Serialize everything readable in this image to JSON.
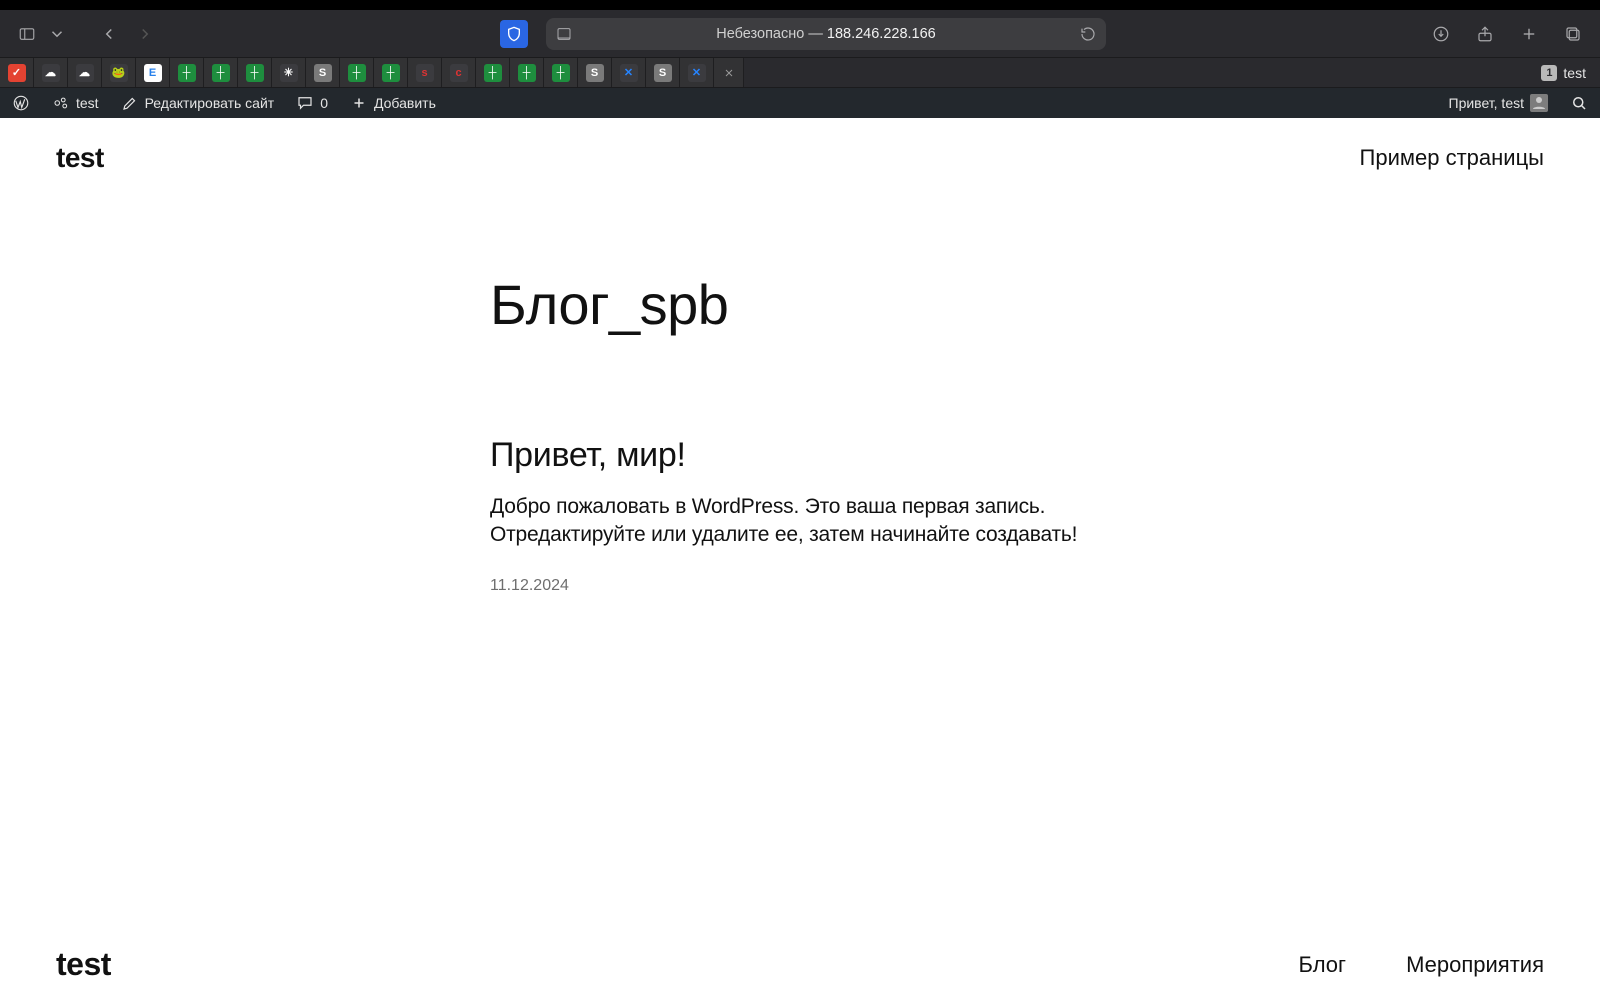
{
  "browser": {
    "address_insecure_label": "Небезопасно — ",
    "address_host": "188.246.228.166",
    "tab_badge": "1",
    "active_tab_title": "test"
  },
  "tabs_favicons": [
    {
      "name": "todoist-icon",
      "bg": "#e44332",
      "glyph": "✓"
    },
    {
      "name": "cloud-icon-1",
      "bg": "#3b3b3f",
      "glyph": "☁"
    },
    {
      "name": "cloud-icon-2",
      "bg": "#3b3b3f",
      "glyph": "☁"
    },
    {
      "name": "frog-icon",
      "bg": "#3b3b3f",
      "glyph": "🐸"
    },
    {
      "name": "e-badge-icon",
      "bg": "#ffffff",
      "glyph": "E",
      "fg": "#2680eb"
    },
    {
      "name": "sheets-icon-1",
      "bg": "#1e8e3e",
      "glyph": "┼"
    },
    {
      "name": "sheets-icon-2",
      "bg": "#1e8e3e",
      "glyph": "┼"
    },
    {
      "name": "sheets-icon-3",
      "bg": "#1e8e3e",
      "glyph": "┼"
    },
    {
      "name": "spark-icon",
      "bg": "#3b3b3f",
      "glyph": "✳"
    },
    {
      "name": "slack-s-icon-1",
      "bg": "#7a7a7a",
      "glyph": "S"
    },
    {
      "name": "sheets-icon-4",
      "bg": "#1e8e3e",
      "glyph": "┼"
    },
    {
      "name": "sheets-icon-5",
      "bg": "#1e8e3e",
      "glyph": "┼"
    },
    {
      "name": "red-s-icon-1",
      "bg": "#3b3b3f",
      "glyph": "s",
      "fg": "#d33"
    },
    {
      "name": "red-c-icon",
      "bg": "#3b3b3f",
      "glyph": "c",
      "fg": "#d33"
    },
    {
      "name": "sheets-icon-6",
      "bg": "#1e8e3e",
      "glyph": "┼"
    },
    {
      "name": "sheets-icon-7",
      "bg": "#1e8e3e",
      "glyph": "┼"
    },
    {
      "name": "sheets-icon-8",
      "bg": "#1e8e3e",
      "glyph": "┼"
    },
    {
      "name": "slack-s-icon-2",
      "bg": "#7a7a7a",
      "glyph": "S"
    },
    {
      "name": "confluence-icon-1",
      "bg": "#3b3b3f",
      "glyph": "✕",
      "fg": "#2684ff"
    },
    {
      "name": "slack-s-icon-3",
      "bg": "#7a7a7a",
      "glyph": "S"
    },
    {
      "name": "confluence-icon-2",
      "bg": "#3b3b3f",
      "glyph": "✕",
      "fg": "#2684ff"
    }
  ],
  "wp_admin": {
    "site_name": "test",
    "edit_site": "Редактировать сайт",
    "comments_count": "0",
    "add_new": "Добавить",
    "greeting": "Привет, test"
  },
  "site": {
    "title": "test",
    "nav_sample_page": "Пример страницы",
    "blog_title": "Блог_spb",
    "post_title": "Привет, мир!",
    "post_excerpt": "Добро пожаловать в WordPress. Это ваша первая запись. Отредактируйте или удалите ее, затем начинайте создавать!",
    "post_date": "11.12.2024",
    "footer_title": "test",
    "footer_nav_blog": "Блог",
    "footer_nav_events": "Мероприятия"
  }
}
